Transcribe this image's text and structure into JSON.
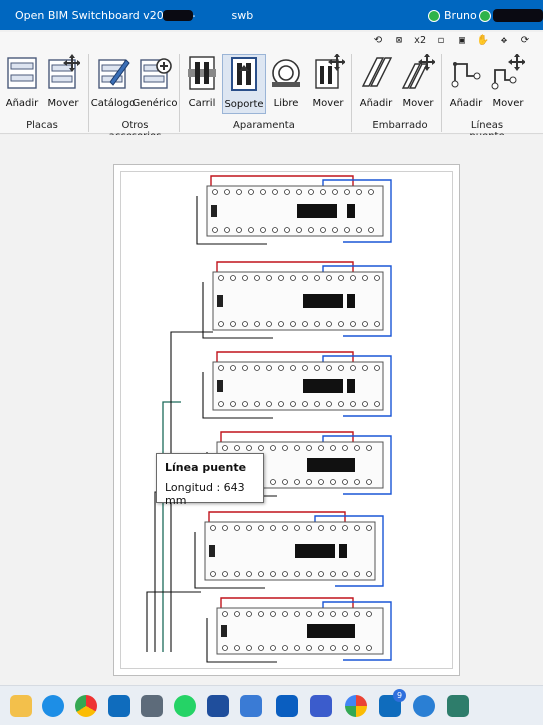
{
  "window": {
    "title": "Open BIM Switchboard v2027.a -",
    "title_suffix": "swb",
    "user": "Bruno"
  },
  "quick_access": [
    "⟲",
    "⊠",
    "x2",
    "◻",
    "▣",
    "✋",
    "✥",
    "⟳"
  ],
  "ribbon": {
    "buttons": [
      {
        "label": "Añadir"
      },
      {
        "label": "Mover"
      },
      {
        "label": "Catálogo"
      },
      {
        "label": "Genérico"
      },
      {
        "label": "Carril"
      },
      {
        "label": "Soporte"
      },
      {
        "label": "Libre"
      },
      {
        "label": "Mover"
      },
      {
        "label": "Añadir"
      },
      {
        "label": "Mover"
      },
      {
        "label": "Añadir"
      },
      {
        "label": "Mover"
      }
    ],
    "groups": [
      "Placas",
      "Otros accesorios",
      "Aparamenta",
      "Embarrado",
      "Líneas puente"
    ]
  },
  "tooltip": {
    "title": "Línea puente",
    "text": "Longitud : 643 mm"
  },
  "taskbar": {
    "badge": "9"
  },
  "colors": {
    "titlebar": "#0067c0",
    "wire_red": "#c0141c",
    "wire_blue": "#1a56d6",
    "wire_black": "#111111",
    "wire_green": "#1c6b5a"
  }
}
